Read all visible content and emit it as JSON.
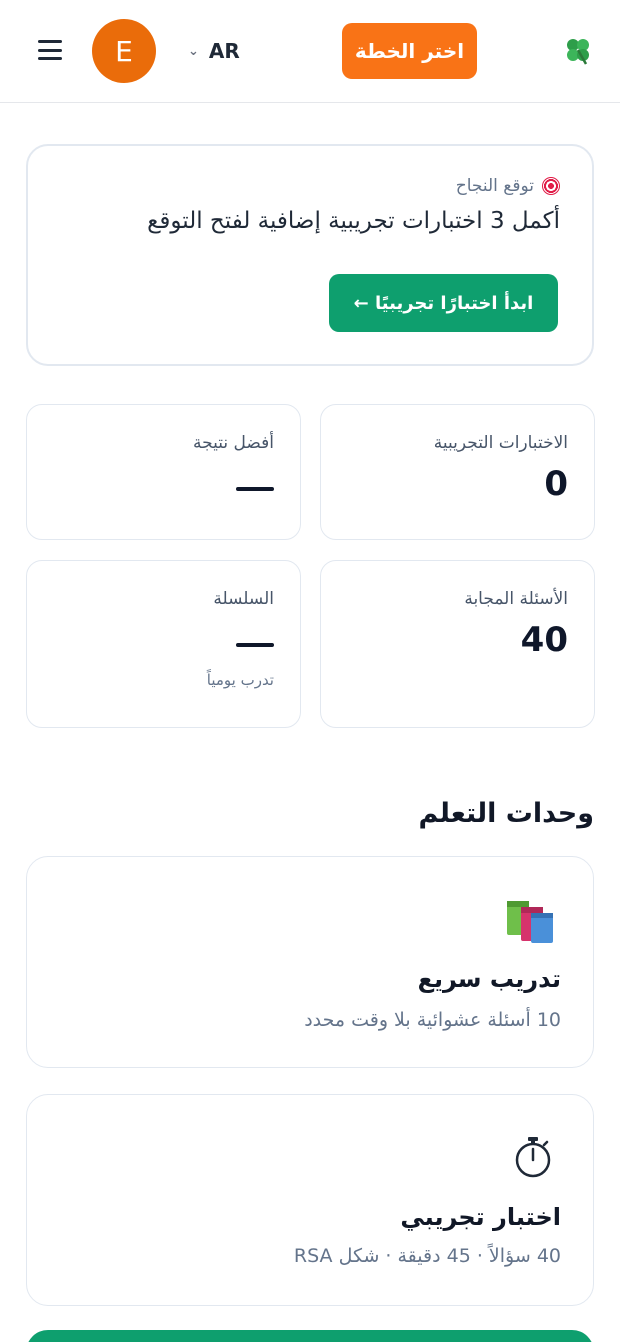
{
  "header": {
    "avatar_letter": "E",
    "language": "AR",
    "plan_button": "اختر الخطة",
    "brand_icon": "four-leaf-clover-icon"
  },
  "prediction": {
    "label": "توقع النجاح",
    "text": "أكمل 3 اختبارات تجريبية إضافية لفتح التوقع",
    "button": "ابدأ اختبارًا تجريبيًا ←"
  },
  "stats": {
    "practice_tests": {
      "label": "الاختبارات التجريبية",
      "value": "0"
    },
    "best_score": {
      "label": "أفضل نتيجة",
      "value": "—"
    },
    "answered": {
      "label": "الأسئلة المجابة",
      "value": "40"
    },
    "streak": {
      "label": "السلسلة",
      "value": "—",
      "sub": "تدرب يومياً"
    }
  },
  "learning": {
    "title": "وحدات التعلم",
    "modules": [
      {
        "icon": "books-icon",
        "title": "تدريب سريع",
        "desc": "10 أسئلة عشوائية بلا وقت محدد"
      },
      {
        "icon": "stopwatch-icon",
        "title": "اختبار تجريبي",
        "desc": "40 سؤالاً · 45 دقيقة · شكل RSA"
      }
    ]
  },
  "colors": {
    "accent_orange": "#f97316",
    "accent_green": "#0e9f6e",
    "avatar_orange": "#ea6c0a"
  }
}
